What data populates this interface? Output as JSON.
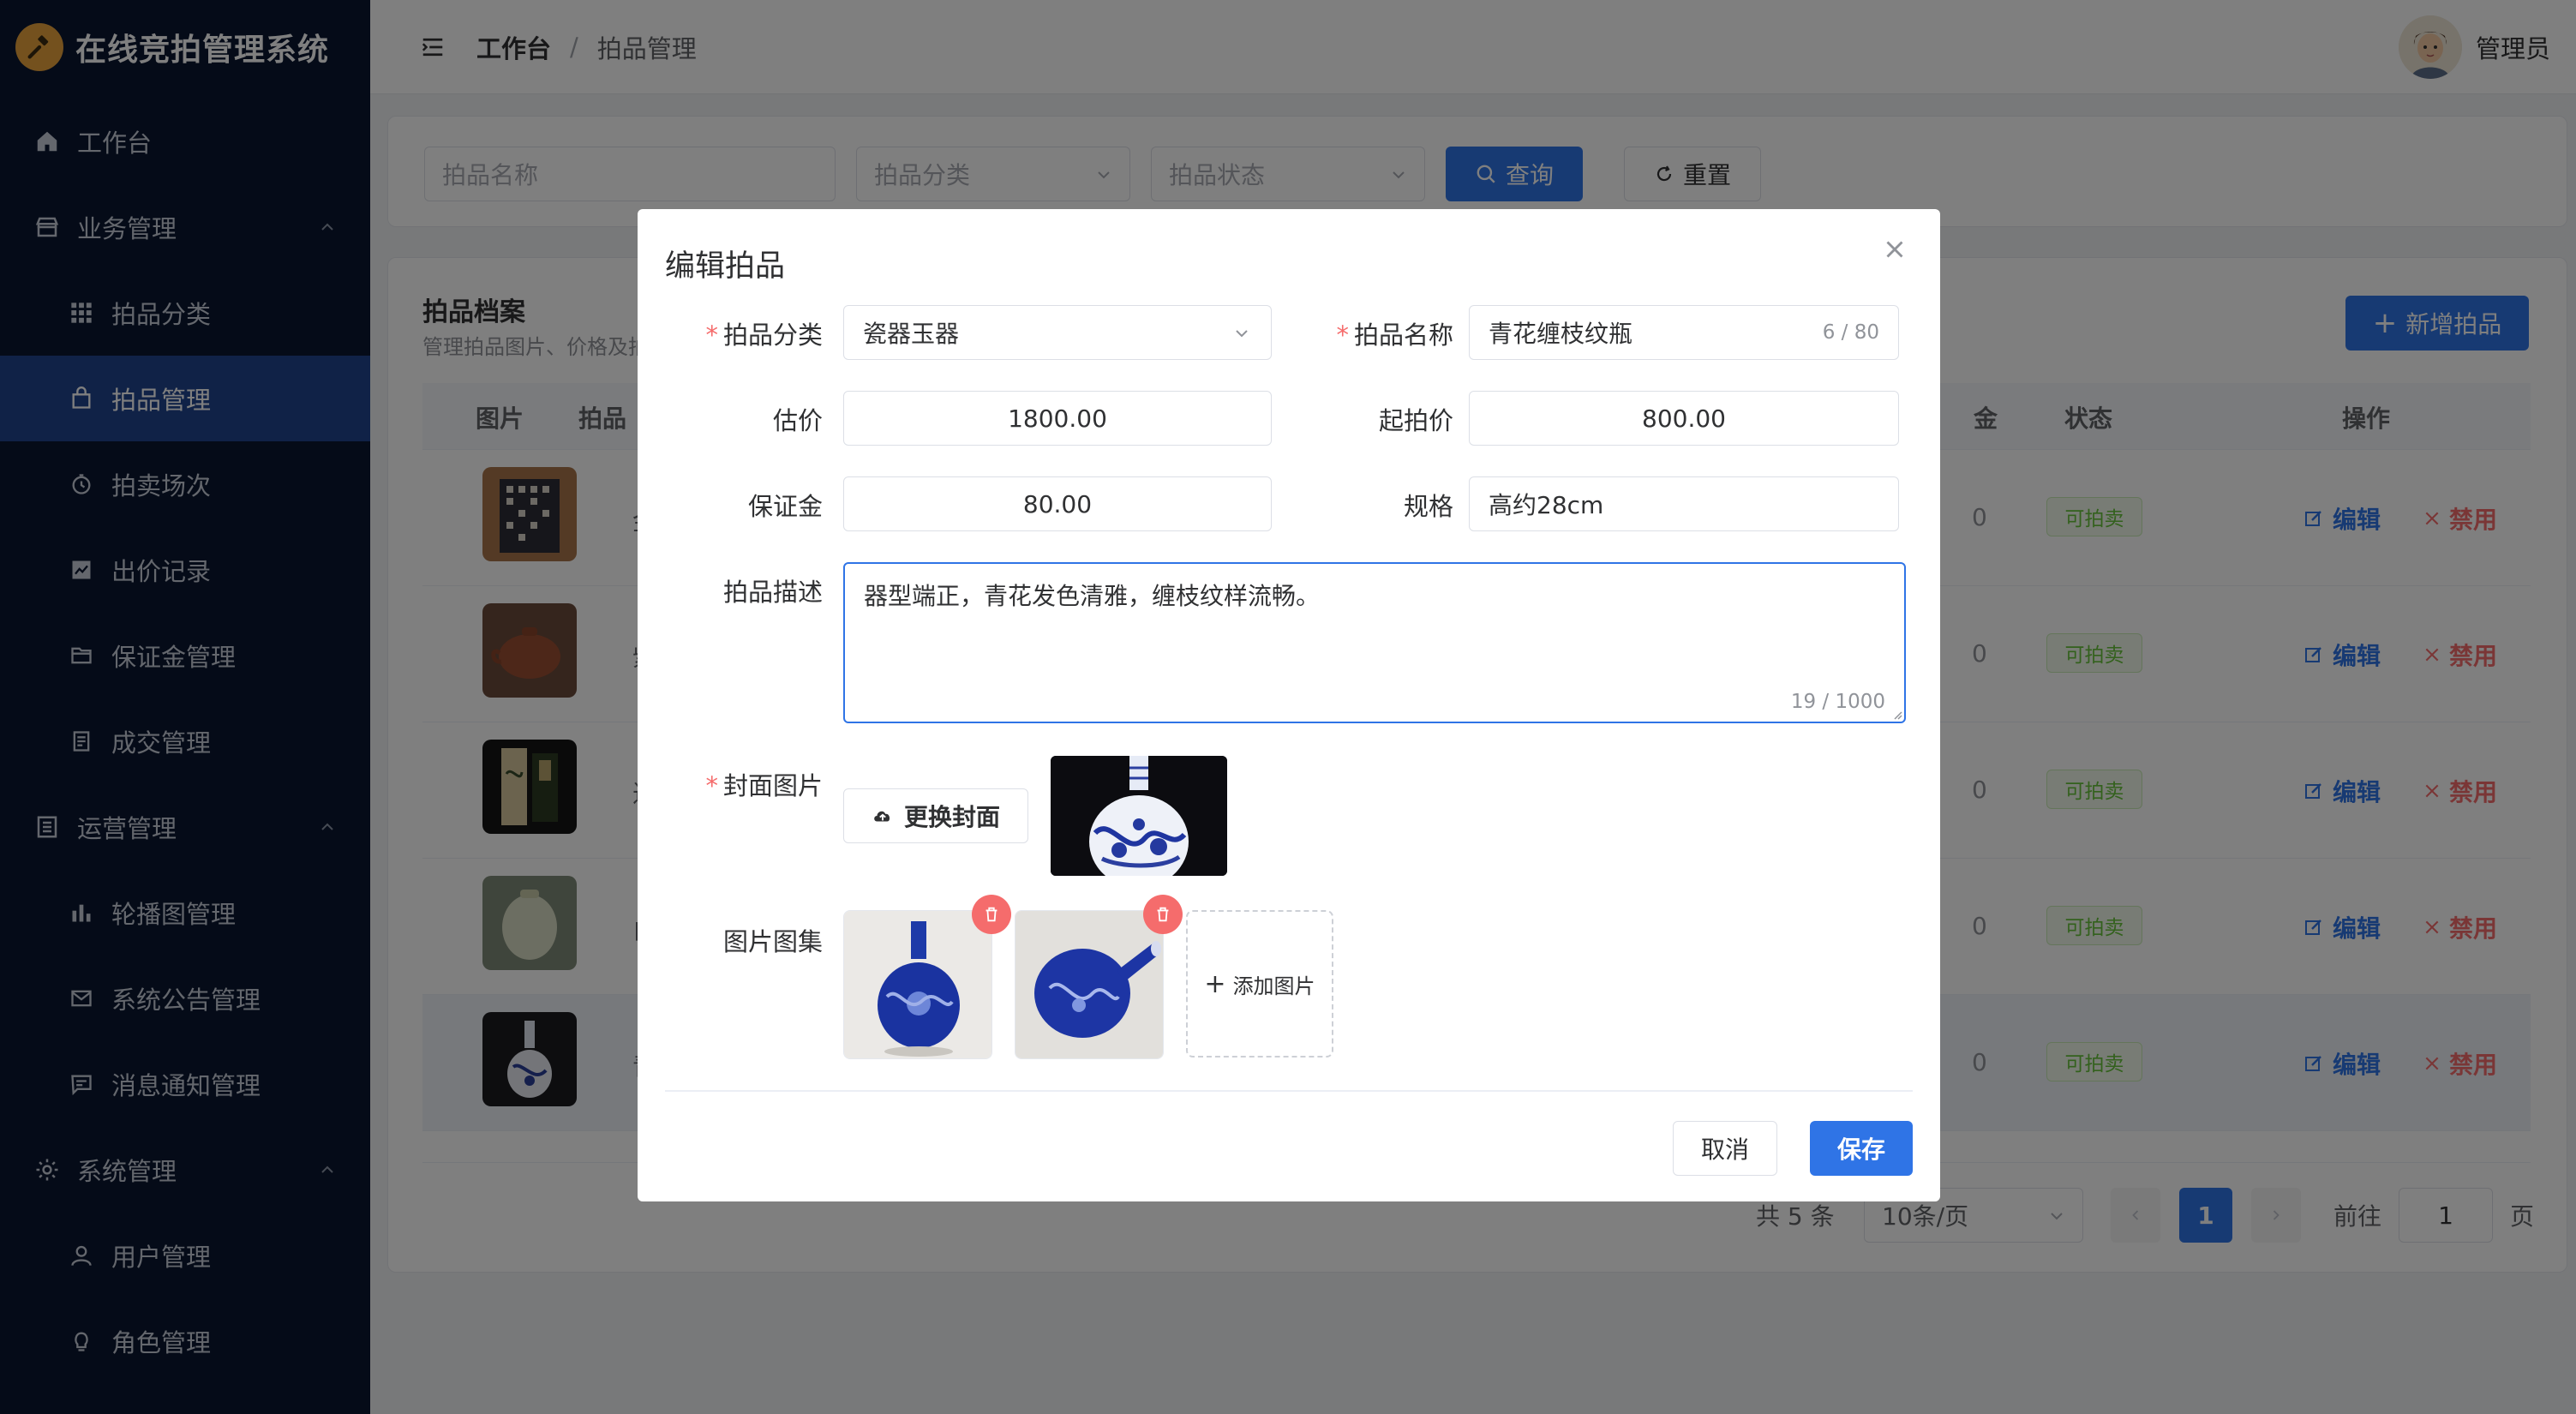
{
  "app": {
    "title": "在线竞拍管理系统"
  },
  "sidebar": {
    "items": [
      {
        "label": "工作台",
        "icon": "home-icon"
      },
      {
        "label": "业务管理",
        "icon": "shop-icon",
        "expanded": true
      },
      {
        "label": "拍品分类",
        "icon": "grid-icon"
      },
      {
        "label": "拍品管理",
        "icon": "bag-icon",
        "active": true
      },
      {
        "label": "拍卖场次",
        "icon": "clock-icon"
      },
      {
        "label": "出价记录",
        "icon": "chart-icon"
      },
      {
        "label": "保证金管理",
        "icon": "folder-icon"
      },
      {
        "label": "成交管理",
        "icon": "document-icon"
      },
      {
        "label": "运营管理",
        "icon": "list-icon",
        "expanded": true
      },
      {
        "label": "轮播图管理",
        "icon": "bar-chart-icon"
      },
      {
        "label": "系统公告管理",
        "icon": "mail-icon"
      },
      {
        "label": "消息通知管理",
        "icon": "message-icon"
      },
      {
        "label": "系统管理",
        "icon": "gear-icon",
        "expanded": true
      },
      {
        "label": "用户管理",
        "icon": "user-icon"
      },
      {
        "label": "角色管理",
        "icon": "bulb-icon"
      }
    ]
  },
  "header": {
    "breadcrumb": [
      "工作台",
      "拍品管理"
    ],
    "separator": "/",
    "user_name": "管理员"
  },
  "search": {
    "name_placeholder": "拍品名称",
    "category_placeholder": "拍品分类",
    "status_placeholder": "拍品状态",
    "query_label": "查询",
    "reset_label": "重置"
  },
  "table": {
    "title": "拍品档案",
    "subtitle": "管理拍品图片、价格及拍",
    "add_label": "新增拍品",
    "columns": {
      "image": "图片",
      "name": "拍品",
      "deposit_cut": "金",
      "status": "状态",
      "actions": "操作"
    },
    "rows": [
      {
        "name": "金石",
        "amount_cut": "0",
        "status": "可拍卖",
        "edit": "编辑",
        "disable": "禁用"
      },
      {
        "name": "紫砂",
        "amount_cut": "0",
        "status": "可拍卖",
        "edit": "编辑",
        "disable": "禁用"
      },
      {
        "name": "近现",
        "amount_cut": "0",
        "status": "可拍卖",
        "edit": "编辑",
        "disable": "禁用"
      },
      {
        "name": "白玉",
        "amount_cut": "0",
        "status": "可拍卖",
        "edit": "编辑",
        "disable": "禁用"
      },
      {
        "name": "青花",
        "amount_cut": "0",
        "status": "可拍卖",
        "edit": "编辑",
        "disable": "禁用"
      }
    ]
  },
  "pagination": {
    "total": "共 5 条",
    "page_size": "10条/页",
    "current_page": "1",
    "goto_label": "前往",
    "goto_value": "1",
    "page_suffix": "页"
  },
  "dialog": {
    "title": "编辑拍品",
    "category_label": "拍品分类",
    "category_value": "瓷器玉器",
    "name_label": "拍品名称",
    "name_value": "青花缠枝纹瓶",
    "name_counter": "6 / 80",
    "estimate_label": "估价",
    "estimate_value": "1800.00",
    "start_price_label": "起拍价",
    "start_price_value": "800.00",
    "deposit_label": "保证金",
    "deposit_value": "80.00",
    "spec_label": "规格",
    "spec_value": "高约28cm",
    "desc_label": "拍品描述",
    "desc_value": "器型端正，青花发色清雅，缠枝纹样流畅。",
    "desc_counter": "19 / 1000",
    "cover_label": "封面图片",
    "change_cover_label": "更换封面",
    "gallery_label": "图片图集",
    "add_image_label": "添加图片",
    "cancel_label": "取消",
    "save_label": "保存"
  },
  "colors": {
    "sidebar_bg": "#0b1730",
    "active_bg": "#21458f",
    "primary": "#2f74e6",
    "danger": "#f56c6c",
    "success": "#67c23a",
    "logo": "#e8a33d"
  }
}
